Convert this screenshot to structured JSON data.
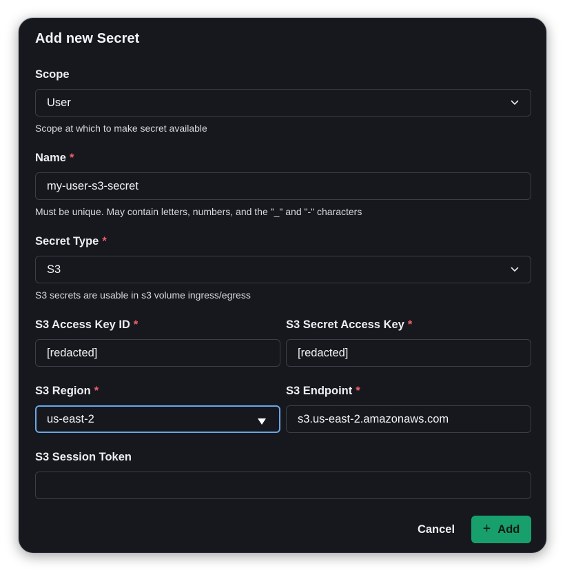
{
  "dialog": {
    "title": "Add new Secret"
  },
  "scope": {
    "label": "Scope",
    "value": "User",
    "help": "Scope at which to make secret available"
  },
  "name": {
    "label": "Name",
    "required_mark": "*",
    "value": "my-user-s3-secret",
    "help": "Must be unique. May contain letters, numbers, and the \"_\" and \"-\" characters"
  },
  "secret_type": {
    "label": "Secret Type",
    "required_mark": "*",
    "value": "S3",
    "help": "S3 secrets are usable in s3 volume ingress/egress"
  },
  "access_key_id": {
    "label": "S3 Access Key ID",
    "required_mark": "*",
    "value": "[redacted]"
  },
  "secret_access_key": {
    "label": "S3 Secret Access Key",
    "required_mark": "*",
    "value": "[redacted]"
  },
  "region": {
    "label": "S3 Region",
    "required_mark": "*",
    "value": "us-east-2"
  },
  "endpoint": {
    "label": "S3 Endpoint",
    "required_mark": "*",
    "value": "s3.us-east-2.amazonaws.com"
  },
  "session_token": {
    "label": "S3 Session Token",
    "value": ""
  },
  "actions": {
    "cancel_label": "Cancel",
    "add_label": "Add",
    "add_icon": "plus-icon"
  },
  "colors": {
    "dialog_bg": "#16181d",
    "accent_green": "#18a06c",
    "required_red": "#ef5f6b",
    "focus_blue": "#6aa7e6"
  }
}
